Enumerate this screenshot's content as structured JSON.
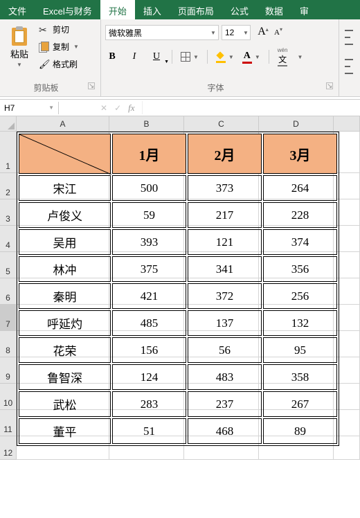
{
  "menu": {
    "file": "文件",
    "excel_finance": "Excel与财务",
    "home": "开始",
    "insert": "插入",
    "page_layout": "页面布局",
    "formulas": "公式",
    "data": "数据",
    "rest": "审"
  },
  "clipboard": {
    "paste": "粘贴",
    "cut": "剪切",
    "copy": "复制",
    "format_painter": "格式刷",
    "group_title": "剪贴板"
  },
  "font": {
    "name": "微软雅黑",
    "size": "12",
    "group_title": "字体",
    "bold": "B",
    "italic": "I",
    "underline": "U",
    "letter_a_big": "A",
    "letter_a_small": "A",
    "color_a": "A",
    "pinyin_top": "wén",
    "pinyin_char": "文"
  },
  "namebox": "H7",
  "fx_label": "fx",
  "columns": [
    "A",
    "B",
    "C",
    "D"
  ],
  "row_numbers": [
    "1",
    "2",
    "3",
    "4",
    "5",
    "6",
    "7",
    "8",
    "9",
    "10",
    "11",
    "12"
  ],
  "active_row": "7",
  "chart_data": {
    "type": "table",
    "headers": [
      "",
      "1月",
      "2月",
      "3月"
    ],
    "rows": [
      {
        "name": "宋江",
        "m1": "500",
        "m2": "373",
        "m3": "264"
      },
      {
        "name": "卢俊义",
        "m1": "59",
        "m2": "217",
        "m3": "228"
      },
      {
        "name": "吴用",
        "m1": "393",
        "m2": "121",
        "m3": "374"
      },
      {
        "name": "林冲",
        "m1": "375",
        "m2": "341",
        "m3": "356"
      },
      {
        "name": "秦明",
        "m1": "421",
        "m2": "372",
        "m3": "256"
      },
      {
        "name": "呼延灼",
        "m1": "485",
        "m2": "137",
        "m3": "132"
      },
      {
        "name": "花荣",
        "m1": "156",
        "m2": "56",
        "m3": "95"
      },
      {
        "name": "鲁智深",
        "m1": "124",
        "m2": "483",
        "m3": "358"
      },
      {
        "name": "武松",
        "m1": "283",
        "m2": "237",
        "m3": "267"
      },
      {
        "name": "董平",
        "m1": "51",
        "m2": "468",
        "m3": "89"
      }
    ]
  }
}
